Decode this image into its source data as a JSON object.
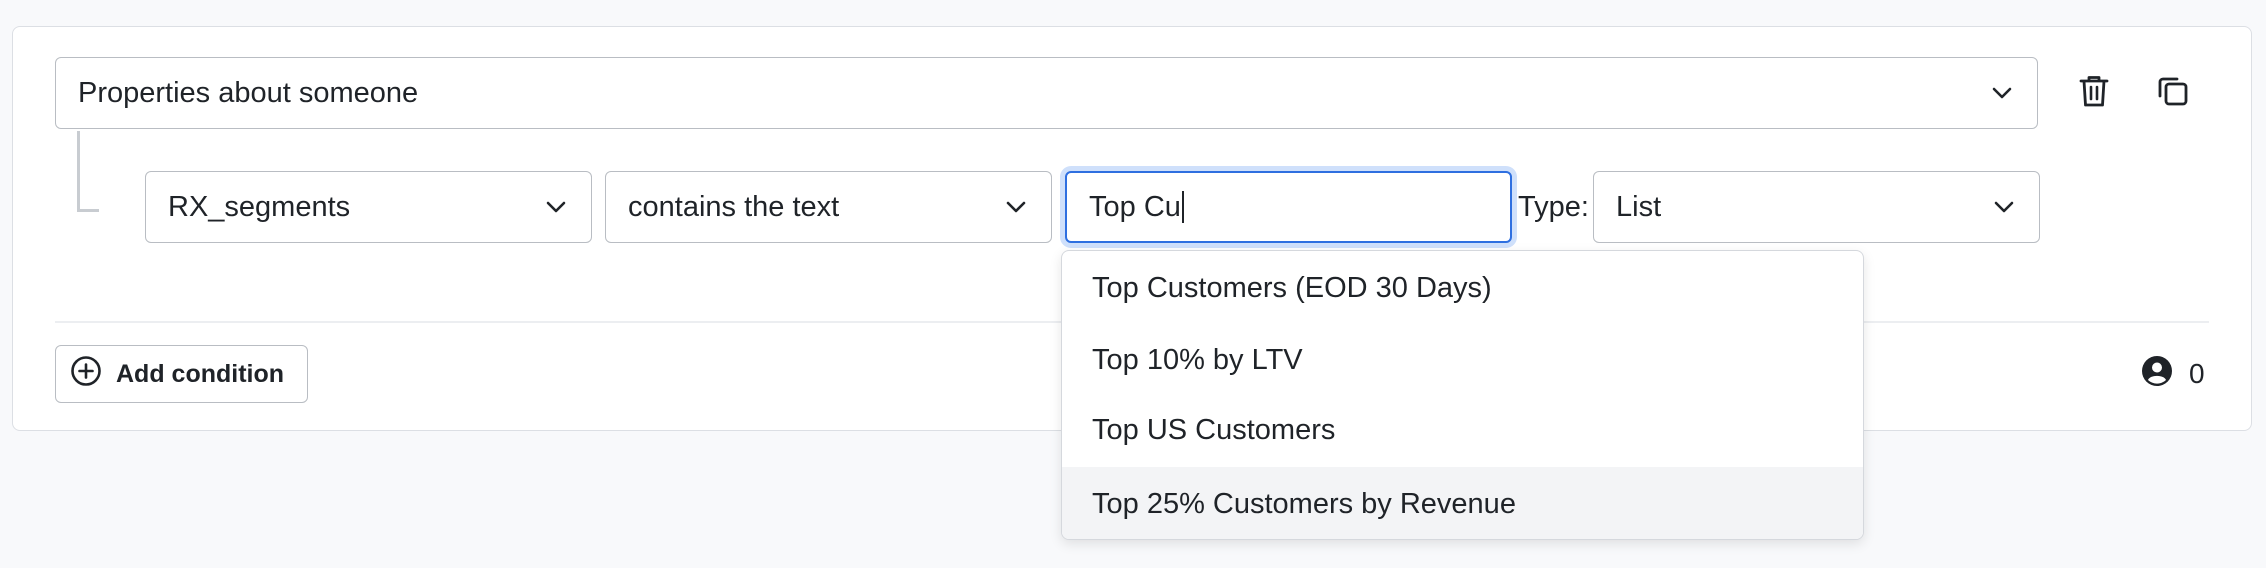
{
  "condition": {
    "property_group": "Properties about someone",
    "field": "RX_segments",
    "operator": "contains the text",
    "value": "Top Cu",
    "type_label": "Type:",
    "type_value": "List"
  },
  "actions": {
    "trash_icon": "trash-icon",
    "copy_icon": "copy-icon"
  },
  "footer": {
    "add_condition_label": "Add condition",
    "person_count": "0"
  },
  "suggestions": [
    "Top Customers (EOD 30 Days)",
    "Top 10% by LTV",
    "Top US Customers",
    "Top 25% Customers by Revenue"
  ],
  "colors": {
    "focus_border": "#2e6fe0",
    "focus_ring": "#cfe0fb",
    "highlight_option": "#f3f4f6"
  }
}
